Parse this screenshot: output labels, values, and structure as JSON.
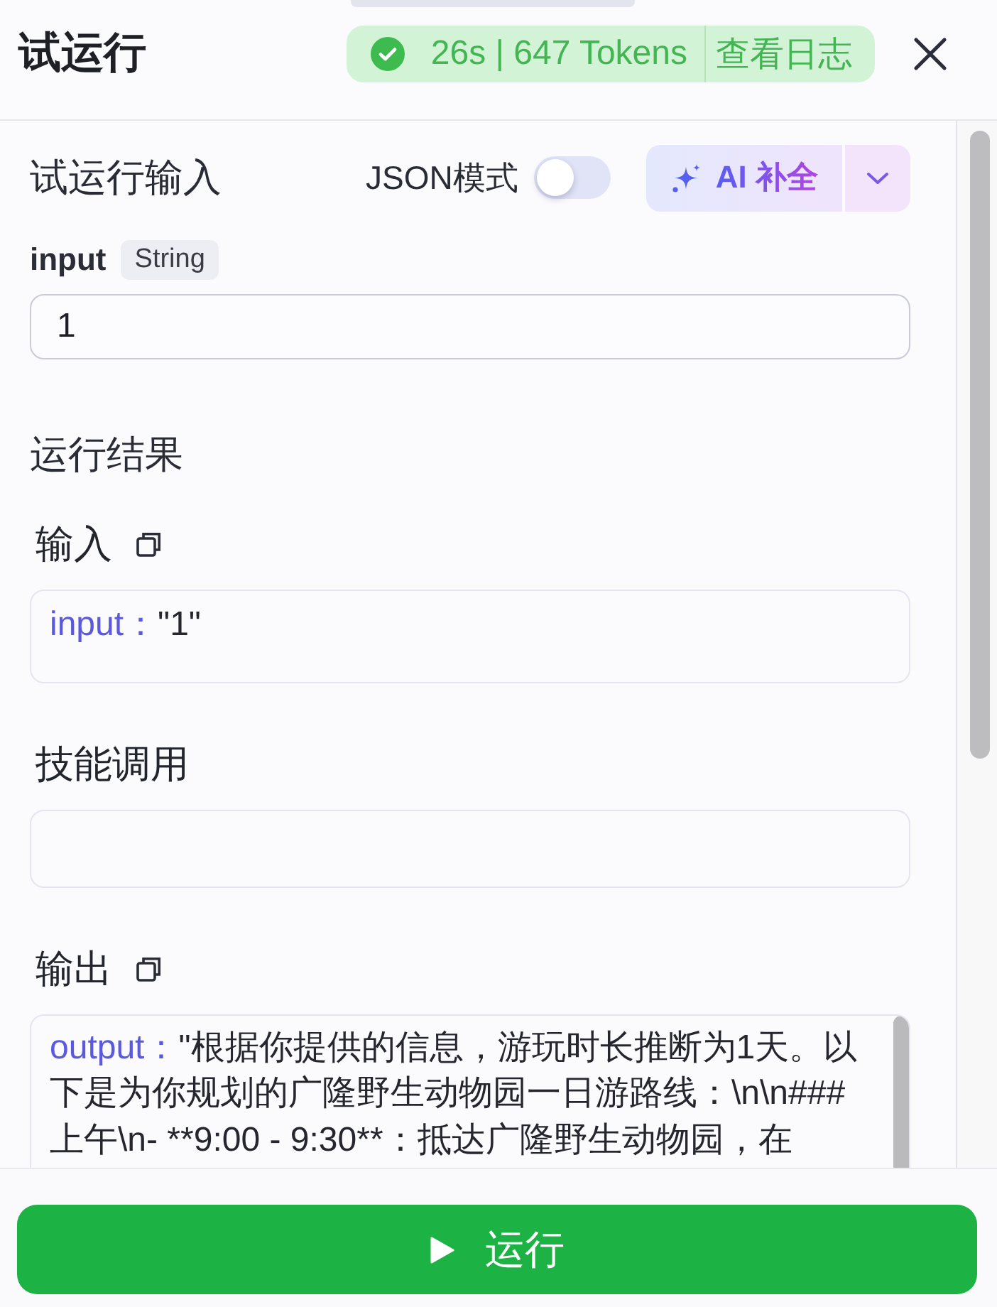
{
  "window": {
    "title": "试运行"
  },
  "run_status": {
    "kind": "success",
    "summary": "26s | 647 Tokens",
    "log_link": "查看日志"
  },
  "trial_input": {
    "title": "试运行输入",
    "json_mode": {
      "label": "JSON模式",
      "on": false
    },
    "ai_button": {
      "label": "AI 补全"
    },
    "fields": [
      {
        "name": "input",
        "type": "String",
        "value": "1"
      }
    ]
  },
  "results": {
    "title": "运行结果",
    "sections": [
      {
        "title": "输入",
        "copyable": true,
        "overflowing": false,
        "entries": [
          {
            "key": "input：",
            "value": "\"1\""
          }
        ]
      },
      {
        "title": "技能调用",
        "copyable": false,
        "overflowing": false
      },
      {
        "title": "输出",
        "copyable": true,
        "overflowing": true,
        "entries": [
          {
            "key": "output：",
            "value": "\"根据你提供的信息，游玩时长推断为1天。以下是为你规划的广隆野生动物园一日游路线：\\n\\n### 上午\\n- **9:00 - 9:30**：抵达广隆野生动物园，在"
          }
        ]
      }
    ]
  },
  "run_button": {
    "label": "运行"
  }
}
